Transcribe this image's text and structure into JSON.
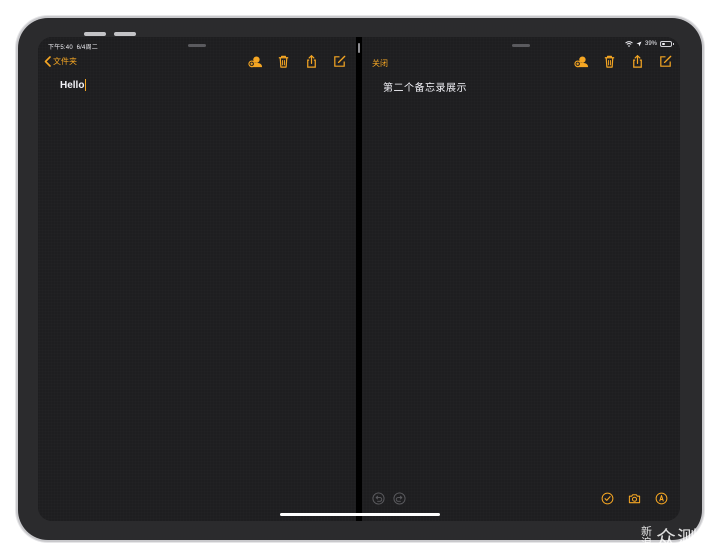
{
  "status_bar": {
    "time": "下午5:40",
    "date": "6/4周二",
    "battery_percent": "39%",
    "battery_level": 0.39
  },
  "left_pane": {
    "back_label": "文件夹",
    "note_text": "Hello"
  },
  "right_pane": {
    "close_label": "关闭",
    "note_text": "第二个备忘录展示"
  },
  "toolbar_icons": [
    "share-person-icon",
    "trash-icon",
    "share-icon",
    "compose-icon"
  ],
  "bottom_icons_left": [
    "undo-icon",
    "redo-icon"
  ],
  "bottom_icons_right": [
    "checklist-icon",
    "camera-icon",
    "markup-icon"
  ],
  "watermark": {
    "sina_top": "新",
    "sina_bottom": "浪",
    "zhongce": "众测"
  },
  "colors": {
    "accent": "#f5a623",
    "background": "#1e1e20",
    "text": "#f2f2f7"
  }
}
